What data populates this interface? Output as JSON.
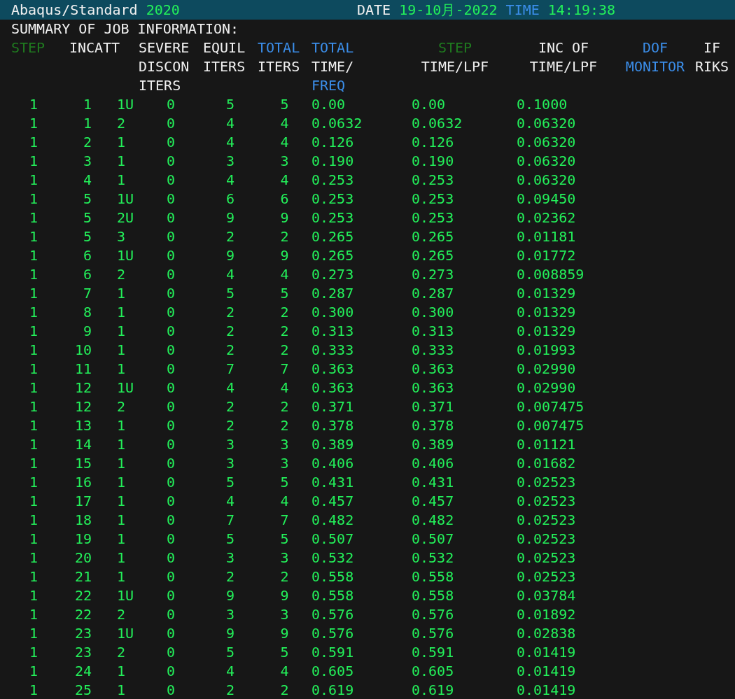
{
  "title_bar": {
    "left": [
      {
        "text": "Abaqus/Standard",
        "color": "#f0f0f0"
      },
      {
        "text": "2020",
        "color": "#23f05a"
      }
    ],
    "right": [
      {
        "text": "DATE",
        "color": "#f0f0f0"
      },
      {
        "text": "19-10月-2022",
        "color": "#23f05a"
      },
      {
        "text": "TIME",
        "color": "#3b8eea"
      },
      {
        "text": "14:19:38",
        "color": "#23f05a"
      }
    ]
  },
  "summary_heading": "SUMMARY OF JOB INFORMATION:",
  "columns": [
    {
      "lines": [
        {
          "text": "STEP",
          "color": "#1f7a1f"
        }
      ]
    },
    {
      "lines": [
        {
          "text": "INC",
          "color": "#f0f0f0"
        }
      ]
    },
    {
      "lines": [
        {
          "text": "ATT",
          "color": "#f0f0f0"
        }
      ]
    },
    {
      "lines": [
        {
          "text": "SEVERE",
          "color": "#f0f0f0"
        },
        {
          "text": "DISCON",
          "color": "#f0f0f0"
        },
        {
          "text": "ITERS",
          "color": "#f0f0f0"
        }
      ]
    },
    {
      "lines": [
        {
          "text": "EQUIL",
          "color": "#f0f0f0"
        },
        {
          "text": "ITERS",
          "color": "#f0f0f0"
        }
      ]
    },
    {
      "lines": [
        {
          "text": "TOTAL",
          "color": "#3b8eea"
        },
        {
          "text": "ITERS",
          "color": "#f0f0f0"
        }
      ]
    },
    {
      "lines": [
        {
          "text": "TOTAL",
          "color": "#3b8eea"
        },
        {
          "text": "TIME/",
          "color": "#f0f0f0"
        },
        {
          "text": "FREQ",
          "color": "#3b8eea"
        }
      ]
    },
    {
      "lines": [
        {
          "text": "STEP",
          "color": "#1f7a1f"
        },
        {
          "text": "TIME/LPF",
          "color": "#f0f0f0"
        }
      ]
    },
    {
      "lines": [
        {
          "text": "INC OF",
          "color": "#f0f0f0"
        },
        {
          "text": "TIME/LPF",
          "color": "#f0f0f0"
        }
      ]
    },
    {
      "lines": [
        {
          "text": "DOF",
          "color": "#3b8eea"
        },
        {
          "text": "MONITOR",
          "color": "#3b8eea"
        }
      ]
    },
    {
      "lines": [
        {
          "text": "IF",
          "color": "#f0f0f0"
        },
        {
          "text": "RIKS",
          "color": "#f0f0f0"
        }
      ]
    }
  ],
  "rows": [
    [
      "1",
      "1",
      "1U",
      "0",
      "5",
      "5",
      "0.00",
      "0.00",
      "0.1000"
    ],
    [
      "1",
      "1",
      "2",
      "0",
      "4",
      "4",
      "0.0632",
      "0.0632",
      "0.06320"
    ],
    [
      "1",
      "2",
      "1",
      "0",
      "4",
      "4",
      "0.126",
      "0.126",
      "0.06320"
    ],
    [
      "1",
      "3",
      "1",
      "0",
      "3",
      "3",
      "0.190",
      "0.190",
      "0.06320"
    ],
    [
      "1",
      "4",
      "1",
      "0",
      "4",
      "4",
      "0.253",
      "0.253",
      "0.06320"
    ],
    [
      "1",
      "5",
      "1U",
      "0",
      "6",
      "6",
      "0.253",
      "0.253",
      "0.09450"
    ],
    [
      "1",
      "5",
      "2U",
      "0",
      "9",
      "9",
      "0.253",
      "0.253",
      "0.02362"
    ],
    [
      "1",
      "5",
      "3",
      "0",
      "2",
      "2",
      "0.265",
      "0.265",
      "0.01181"
    ],
    [
      "1",
      "6",
      "1U",
      "0",
      "9",
      "9",
      "0.265",
      "0.265",
      "0.01772"
    ],
    [
      "1",
      "6",
      "2",
      "0",
      "4",
      "4",
      "0.273",
      "0.273",
      "0.008859"
    ],
    [
      "1",
      "7",
      "1",
      "0",
      "5",
      "5",
      "0.287",
      "0.287",
      "0.01329"
    ],
    [
      "1",
      "8",
      "1",
      "0",
      "2",
      "2",
      "0.300",
      "0.300",
      "0.01329"
    ],
    [
      "1",
      "9",
      "1",
      "0",
      "2",
      "2",
      "0.313",
      "0.313",
      "0.01329"
    ],
    [
      "1",
      "10",
      "1",
      "0",
      "2",
      "2",
      "0.333",
      "0.333",
      "0.01993"
    ],
    [
      "1",
      "11",
      "1",
      "0",
      "7",
      "7",
      "0.363",
      "0.363",
      "0.02990"
    ],
    [
      "1",
      "12",
      "1U",
      "0",
      "4",
      "4",
      "0.363",
      "0.363",
      "0.02990"
    ],
    [
      "1",
      "12",
      "2",
      "0",
      "2",
      "2",
      "0.371",
      "0.371",
      "0.007475"
    ],
    [
      "1",
      "13",
      "1",
      "0",
      "2",
      "2",
      "0.378",
      "0.378",
      "0.007475"
    ],
    [
      "1",
      "14",
      "1",
      "0",
      "3",
      "3",
      "0.389",
      "0.389",
      "0.01121"
    ],
    [
      "1",
      "15",
      "1",
      "0",
      "3",
      "3",
      "0.406",
      "0.406",
      "0.01682"
    ],
    [
      "1",
      "16",
      "1",
      "0",
      "5",
      "5",
      "0.431",
      "0.431",
      "0.02523"
    ],
    [
      "1",
      "17",
      "1",
      "0",
      "4",
      "4",
      "0.457",
      "0.457",
      "0.02523"
    ],
    [
      "1",
      "18",
      "1",
      "0",
      "7",
      "7",
      "0.482",
      "0.482",
      "0.02523"
    ],
    [
      "1",
      "19",
      "1",
      "0",
      "5",
      "5",
      "0.507",
      "0.507",
      "0.02523"
    ],
    [
      "1",
      "20",
      "1",
      "0",
      "3",
      "3",
      "0.532",
      "0.532",
      "0.02523"
    ],
    [
      "1",
      "21",
      "1",
      "0",
      "2",
      "2",
      "0.558",
      "0.558",
      "0.02523"
    ],
    [
      "1",
      "22",
      "1U",
      "0",
      "9",
      "9",
      "0.558",
      "0.558",
      "0.03784"
    ],
    [
      "1",
      "22",
      "2",
      "0",
      "3",
      "3",
      "0.576",
      "0.576",
      "0.01892"
    ],
    [
      "1",
      "23",
      "1U",
      "0",
      "9",
      "9",
      "0.576",
      "0.576",
      "0.02838"
    ],
    [
      "1",
      "23",
      "2",
      "0",
      "5",
      "5",
      "0.591",
      "0.591",
      "0.01419"
    ],
    [
      "1",
      "24",
      "1",
      "0",
      "4",
      "4",
      "0.605",
      "0.605",
      "0.01419"
    ],
    [
      "1",
      "25",
      "1",
      "0",
      "2",
      "2",
      "0.619",
      "0.619",
      "0.01419"
    ]
  ]
}
